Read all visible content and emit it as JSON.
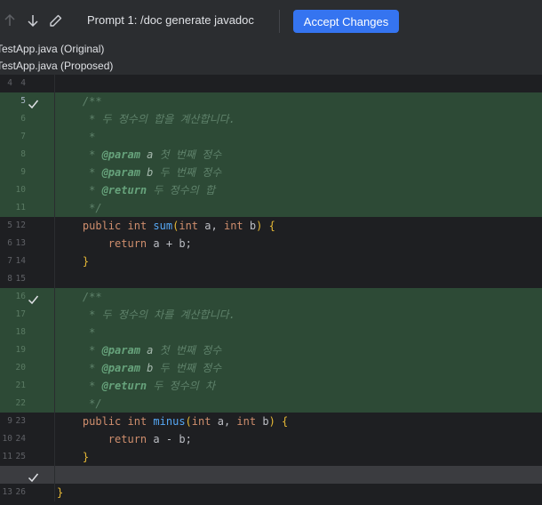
{
  "toolbar": {
    "prompt_text": "Prompt 1: /doc generate javadoc",
    "accept_label": "Accept Changes",
    "icons": [
      "arrow-up-icon",
      "arrow-down-icon",
      "pencil-icon"
    ]
  },
  "files": {
    "original": "TestApp.java (Original)",
    "proposed": "TestApp.java (Proposed)"
  },
  "colors": {
    "accent": "#3574f0",
    "added_background": "#2d4a36",
    "editor_background": "#1e1f22"
  },
  "lines": [
    {
      "old": "4",
      "new": "4",
      "code": ""
    },
    {
      "old": "",
      "new": "5",
      "code": "    /**"
    },
    {
      "old": "",
      "new": "6",
      "code": "     * 두 정수의 합을 계산합니다."
    },
    {
      "old": "",
      "new": "7",
      "code": "     *"
    },
    {
      "old": "",
      "new": "8",
      "code": "     * @param a 첫 번째 정수"
    },
    {
      "old": "",
      "new": "9",
      "code": "     * @param b 두 번째 정수"
    },
    {
      "old": "",
      "new": "10",
      "code": "     * @return 두 정수의 합"
    },
    {
      "old": "",
      "new": "11",
      "code": "     */"
    },
    {
      "old": "5",
      "new": "12",
      "code": "    public int sum(int a, int b) {"
    },
    {
      "old": "6",
      "new": "13",
      "code": "        return a + b;"
    },
    {
      "old": "7",
      "new": "14",
      "code": "    }"
    },
    {
      "old": "8",
      "new": "15",
      "code": ""
    },
    {
      "old": "",
      "new": "16",
      "code": "    /**"
    },
    {
      "old": "",
      "new": "17",
      "code": "     * 두 정수의 차를 계산합니다."
    },
    {
      "old": "",
      "new": "18",
      "code": "     *"
    },
    {
      "old": "",
      "new": "19",
      "code": "     * @param a 첫 번째 정수"
    },
    {
      "old": "",
      "new": "20",
      "code": "     * @param b 두 번째 정수"
    },
    {
      "old": "",
      "new": "21",
      "code": "     * @return 두 정수의 차"
    },
    {
      "old": "",
      "new": "22",
      "code": "     */"
    },
    {
      "old": "9",
      "new": "23",
      "code": "    public int minus(int a, int b) {"
    },
    {
      "old": "10",
      "new": "24",
      "code": "        return a - b;"
    },
    {
      "old": "11",
      "new": "25",
      "code": "    }"
    },
    {
      "old": "",
      "new": "",
      "code": ""
    },
    {
      "old": "13",
      "new": "26",
      "code": "}"
    }
  ]
}
